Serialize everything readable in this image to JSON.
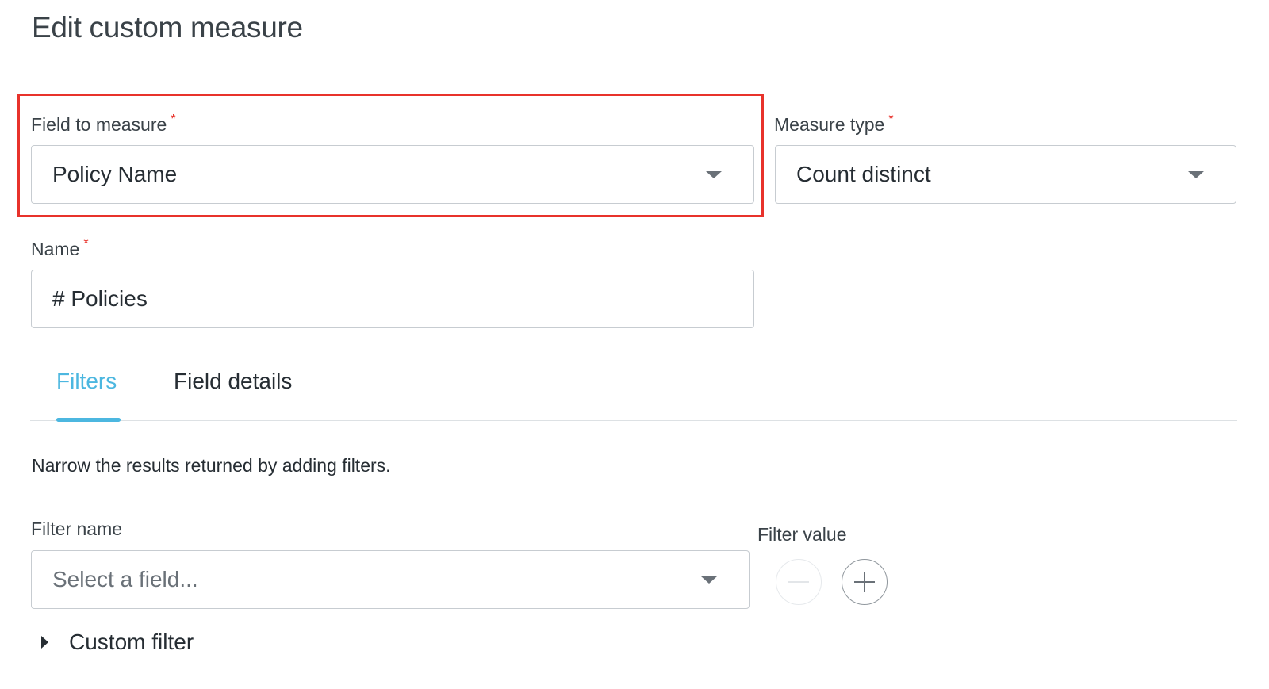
{
  "page": {
    "title": "Edit custom measure"
  },
  "colors": {
    "accent": "#4cb7e0",
    "required": "#e8322b",
    "highlight_box": "#e8322b"
  },
  "form": {
    "field_to_measure": {
      "label": "Field to measure",
      "required_mark": "*",
      "value": "Policy Name",
      "icon": "chevron-down-icon"
    },
    "measure_type": {
      "label": "Measure type",
      "required_mark": "*",
      "value": "Count distinct",
      "icon": "chevron-down-icon"
    },
    "name": {
      "label": "Name",
      "required_mark": "*",
      "value": "# Policies"
    }
  },
  "tabs": [
    {
      "label": "Filters",
      "active": true
    },
    {
      "label": "Field details",
      "active": false
    }
  ],
  "filters": {
    "helper_text": "Narrow the results returned by adding filters.",
    "filter_name_label": "Filter name",
    "filter_name_placeholder": "Select a field...",
    "filter_value_label": "Filter value",
    "remove_icon": "minus-circle-icon",
    "add_icon": "plus-circle-icon",
    "custom_filter_label": "Custom filter"
  }
}
